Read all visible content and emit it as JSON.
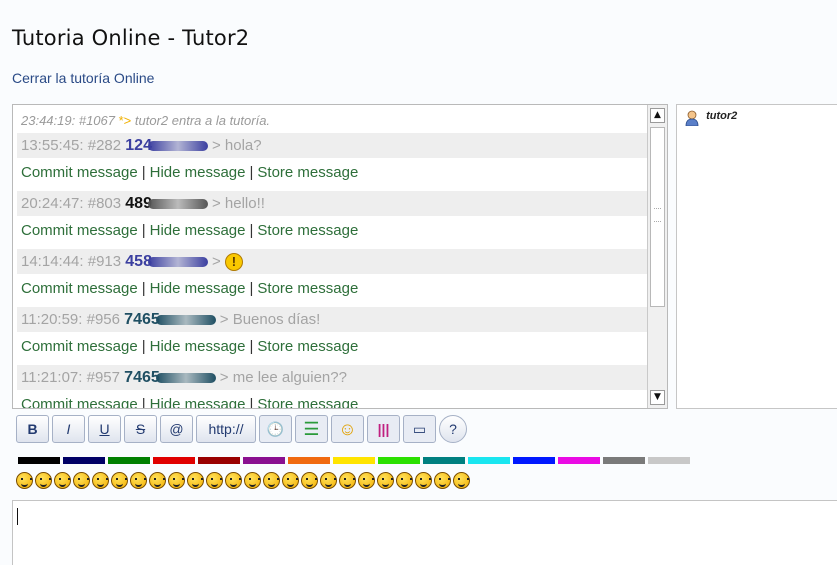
{
  "page": {
    "title": "Tutoria Online - Tutor2",
    "close_link": "Cerrar la tutoría Online"
  },
  "chat": {
    "system_message": {
      "time": "23:44:19:",
      "id": "#1067",
      "arrow": "*>",
      "text": "tutor2 entra a la tutoría."
    },
    "action_labels": {
      "commit": "Commit message",
      "hide": "Hide message",
      "store": "Store message",
      "separator": "|"
    },
    "messages": [
      {
        "time": "13:55:45:",
        "id": "#282",
        "user": "124",
        "user_color": "#3b3fa0",
        "blur_color": "#3b3fa0",
        "text": "> hola?",
        "emoji": false
      },
      {
        "time": "20:24:47:",
        "id": "#803",
        "user": "489",
        "user_color": "#111111",
        "blur_color": "#555555",
        "text": "> hello!!",
        "emoji": false
      },
      {
        "time": "14:14:44:",
        "id": "#913",
        "user": "458",
        "user_color": "#3b3fa0",
        "blur_color": "#3b3fa0",
        "text": ">",
        "emoji": true,
        "emoji_glyph": "!"
      },
      {
        "time": "11:20:59:",
        "id": "#956",
        "user": "7465",
        "user_color": "#1f4f63",
        "blur_color": "#1f4f63",
        "text": "> Buenos días!",
        "emoji": false
      },
      {
        "time": "11:21:07:",
        "id": "#957",
        "user": "7465",
        "user_color": "#1f4f63",
        "blur_color": "#1f4f63",
        "text": "> me lee alguien??",
        "emoji": false
      }
    ],
    "scrollbar": {
      "up_glyph": "▲",
      "down_glyph": "▼"
    }
  },
  "users": {
    "list": [
      {
        "name": "tutor2"
      }
    ]
  },
  "toolbar": {
    "buttons": [
      {
        "label": "B",
        "name": "bold-button"
      },
      {
        "label": "I",
        "name": "italic-button"
      },
      {
        "label": "U",
        "name": "underline-button"
      },
      {
        "label": "S",
        "name": "strikethrough-button"
      },
      {
        "label": "@",
        "name": "email-button"
      },
      {
        "label": "http://",
        "name": "url-button"
      },
      {
        "label": "🕒",
        "name": "time-button"
      },
      {
        "label": "☰",
        "name": "list-button"
      },
      {
        "label": "☺",
        "name": "smiley-button"
      },
      {
        "label": "|||",
        "name": "color-button"
      },
      {
        "label": "▭",
        "name": "window-button"
      },
      {
        "label": "?",
        "name": "help-button"
      }
    ]
  },
  "palette": {
    "colors": [
      "#000000",
      "#000066",
      "#008000",
      "#e00000",
      "#990000",
      "#8a1090",
      "#f06a10",
      "#ffe400",
      "#2be000",
      "#008080",
      "#19e6f0",
      "#0018ff",
      "#ea0ae4",
      "#7a7a7a",
      "#c8c8c8"
    ]
  },
  "smileys": {
    "count": 24
  },
  "input": {
    "value": ""
  }
}
